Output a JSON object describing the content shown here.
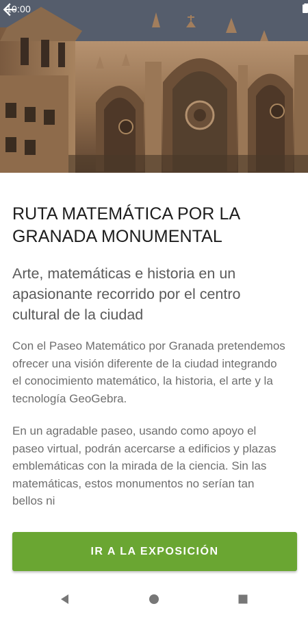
{
  "status_bar": {
    "time": "10:00",
    "icons": [
      "wifi-icon",
      "signal-icon",
      "battery-icon"
    ]
  },
  "header": {
    "back_icon": "arrow-back-icon"
  },
  "hero": {
    "image": "granada-cathedral-facade"
  },
  "article": {
    "title": "RUTA MATEMÁTICA POR LA GRANADA MONUMENTAL",
    "subtitle": "Arte, matemáticas e historia en un apasionante recorrido por el centro cultural de la ciudad",
    "paragraphs": [
      "Con el Paseo Matemático por Granada pretendemos ofrecer una visión diferente de la ciudad integrando el conocimiento matemático, la historia, el arte y la tecnología GeoGebra.",
      "En un agradable paseo, usando como apoyo el paseo virtual, podrán acercarse a edificios y plazas emblemáticas con la mirada de la ciencia. Sin las matemáticas, estos monumentos no serían tan bellos ni"
    ]
  },
  "cta": {
    "label": "IR A LA EXPOSICIÓN"
  },
  "colors": {
    "accent": "#6aa632",
    "title": "#1d1d1d",
    "subtitle": "#5a5a5a",
    "body": "#6e6e6e"
  },
  "nav": {
    "icons": [
      "back-triangle-icon",
      "home-circle-icon",
      "recents-square-icon"
    ]
  }
}
